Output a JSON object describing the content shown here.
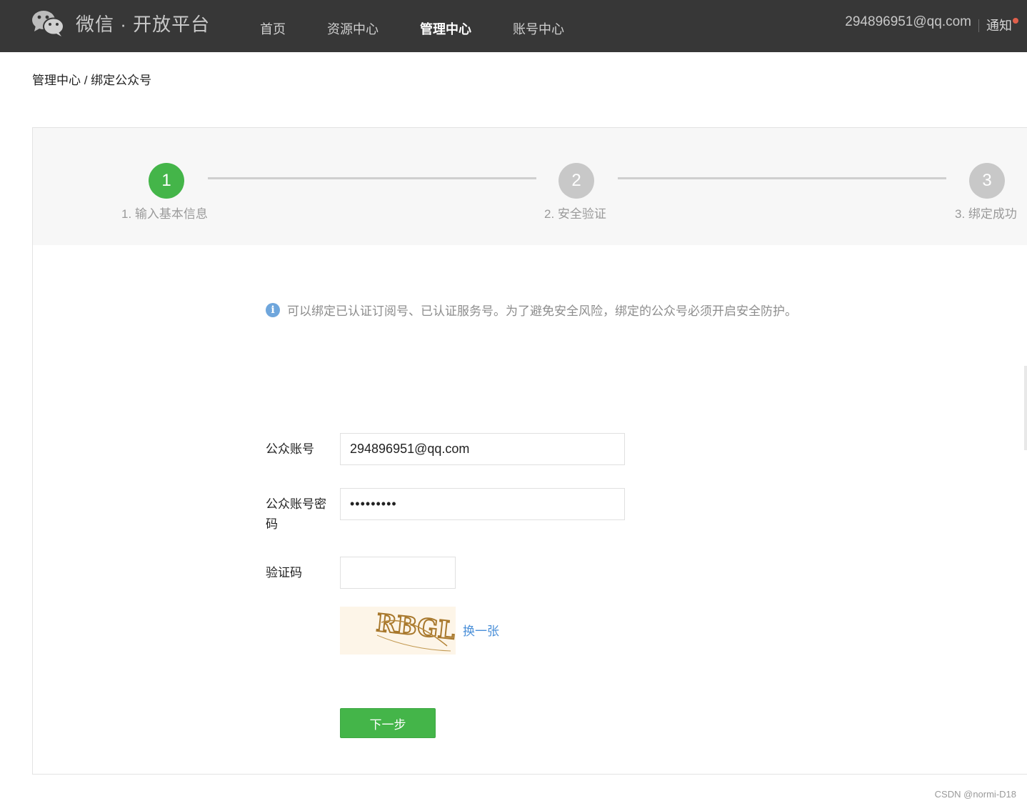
{
  "header": {
    "logo_text": "微信 · 开放平台",
    "nav": [
      {
        "label": "首页",
        "active": false
      },
      {
        "label": "资源中心",
        "active": false
      },
      {
        "label": "管理中心",
        "active": true
      },
      {
        "label": "账号中心",
        "active": false
      }
    ],
    "account": "294896951@qq.com",
    "notice": "通知"
  },
  "breadcrumb": {
    "parent": "管理中心",
    "separator": " / ",
    "current": "绑定公众号"
  },
  "steps": [
    {
      "number": "1",
      "label": "1. 输入基本信息",
      "state": "done"
    },
    {
      "number": "2",
      "label": "2. 安全验证",
      "state": "todo"
    },
    {
      "number": "3",
      "label": "3. 绑定成功",
      "state": "todo"
    }
  ],
  "tip": {
    "icon": "i",
    "text": "可以绑定已认证订阅号、已认证服务号。为了避免安全风险，绑定的公众号必须开启安全防护。"
  },
  "form": {
    "account_label": "公众账号",
    "account_value": "294896951@qq.com",
    "password_label_line1": "公众账号密",
    "password_label_line2": "码",
    "password_value": "•••••••••",
    "captcha_label": "验证码",
    "captcha_value": "",
    "captcha_image_text": "RBGL",
    "refresh_label": "换一张",
    "next_label": "下一步"
  },
  "watermark": "CSDN @normi-D18",
  "colors": {
    "topbar": "#373737",
    "primary_green": "#44b549",
    "link_blue": "#4a8fd8",
    "step_gray": "#c8c8c8"
  }
}
